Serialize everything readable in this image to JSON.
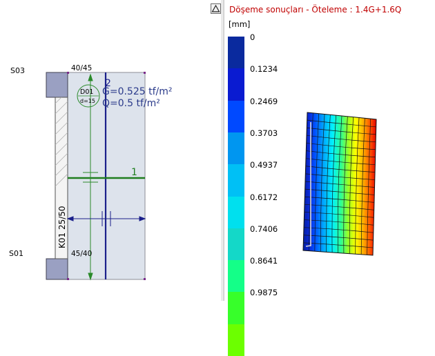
{
  "left_panel": {
    "label_s03": "S03",
    "label_s01": "S01",
    "beam_top": "40/45",
    "beam_bottom": "45/40",
    "beam_side": "K01 25/50",
    "slab_code": "D01",
    "slab_thickness": "d=15",
    "load_g": "G=0.525 tf/m²",
    "load_q": "Q=0.5 tf/m²",
    "axis_1": "1",
    "axis_2": "2"
  },
  "right_panel": {
    "title": "Döşeme sonuçları - Öteleme : 1.4G+1.6Q",
    "unit": "[mm]",
    "legend": {
      "labels": [
        "0",
        "0.1234",
        "0.2469",
        "0.3703",
        "0.4937",
        "0.6172",
        "0.7406",
        "0.8641",
        "0.9875"
      ],
      "colors": [
        "#0a2a9e",
        "#0a1bd1",
        "#0049ff",
        "#0096f0",
        "#00c0f5",
        "#00e0ee",
        "#14d8c8",
        "#14ff88",
        "#37ff2a",
        "#6cff00"
      ]
    }
  },
  "collapse_button": {
    "icon": "triangle-up-icon"
  }
}
